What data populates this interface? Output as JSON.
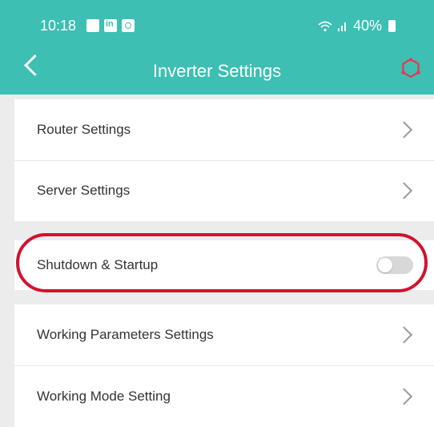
{
  "status_bar": {
    "time": "10:18",
    "battery": "40%"
  },
  "header": {
    "title": "Inverter Settings",
    "background_color": "#3dbfb3",
    "back_icon": "chevron-left-icon",
    "settings_icon": "hexagon-gear-icon",
    "settings_icon_color": "#e8384f"
  },
  "groups": [
    {
      "items": [
        {
          "label": "Router Settings",
          "control": "chevron"
        },
        {
          "label": "Server Settings",
          "control": "chevron"
        }
      ]
    },
    {
      "items": [
        {
          "label": "Shutdown & Startup",
          "control": "toggle",
          "toggle_on": false
        }
      ]
    },
    {
      "items": [
        {
          "label": "Working Parameters Settings",
          "control": "chevron"
        },
        {
          "label": "Working Mode Setting",
          "control": "chevron"
        }
      ]
    }
  ],
  "highlight_color": "#d2122e"
}
